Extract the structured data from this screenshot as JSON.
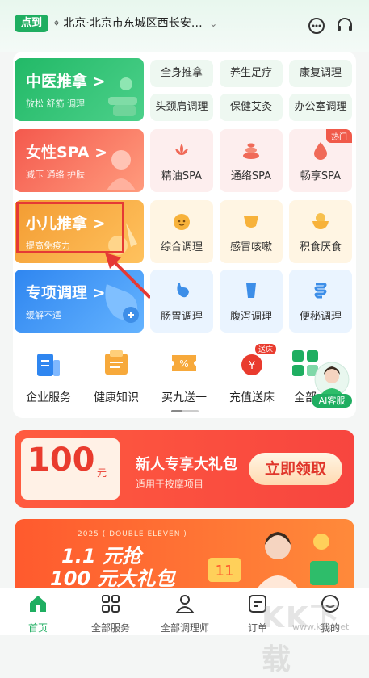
{
  "header": {
    "logo_label": "点到",
    "location": "北京·北京市东城区西长安…",
    "icons": [
      "message-icon",
      "customer-service-icon"
    ]
  },
  "grid": {
    "big_tiles": [
      {
        "title": "中医推拿 >",
        "subtitle": "放松 舒筋 调理",
        "color": "#2ebd6a"
      },
      {
        "title": "女性SPA >",
        "subtitle": "减压 通络 护肤",
        "color": "#f46a5a"
      },
      {
        "title": "小儿推拿 >",
        "subtitle": "提高免疫力",
        "color": "#f5a53a"
      },
      {
        "title": "专项调理 >",
        "subtitle": "缓解不适",
        "color": "#3a8ff0"
      }
    ],
    "row1_small": [
      "全身推拿",
      "养生足疗",
      "康复调理",
      "头颈肩调理",
      "保健艾灸",
      "办公室调理"
    ],
    "row2": [
      {
        "label": "精油SPA",
        "icon": "lotus-icon"
      },
      {
        "label": "通络SPA",
        "icon": "stones-icon"
      },
      {
        "label": "畅享SPA",
        "icon": "oil-drop-icon",
        "tag": "热门"
      }
    ],
    "row3": [
      {
        "label": "综合调理",
        "icon": "baby-face-icon"
      },
      {
        "label": "感冒咳嗽",
        "icon": "cup-icon"
      },
      {
        "label": "积食厌食",
        "icon": "bowl-icon"
      }
    ],
    "row4": [
      {
        "label": "肠胃调理",
        "icon": "stomach-icon"
      },
      {
        "label": "腹泻调理",
        "icon": "abdomen-icon"
      },
      {
        "label": "便秘调理",
        "icon": "intestine-icon"
      }
    ]
  },
  "quick_nav": [
    {
      "label": "企业服务",
      "icon": "enterprise-icon"
    },
    {
      "label": "健康知识",
      "icon": "health-knowledge-icon"
    },
    {
      "label": "买九送一",
      "icon": "coupon-icon"
    },
    {
      "label": "充值送床",
      "icon": "recharge-icon",
      "badge": "送床"
    },
    {
      "label": "全部",
      "icon": "all-icon"
    }
  ],
  "ai_label": "AI客服",
  "promo": {
    "amount": "100",
    "unit": "元",
    "title": "新人专享大礼包",
    "subtitle": "适用于按摩项目",
    "button": "立即领取"
  },
  "banner": {
    "small_text": "2025 ( DOUBLE ELEVEN )",
    "line1": "1.1 元抢",
    "line2": "100 元大礼包"
  },
  "tabbar": [
    {
      "label": "首页",
      "icon": "home-icon",
      "active": true
    },
    {
      "label": "全部服务",
      "icon": "grid-icon"
    },
    {
      "label": "全部调理师",
      "icon": "therapist-icon"
    },
    {
      "label": "订单",
      "icon": "order-icon"
    },
    {
      "label": "我的",
      "icon": "profile-icon"
    }
  ],
  "watermark": {
    "big": "KK下载",
    "small": "www.kkx.net"
  },
  "colors": {
    "brand": "#1fae61",
    "highlight": "#e53935"
  }
}
